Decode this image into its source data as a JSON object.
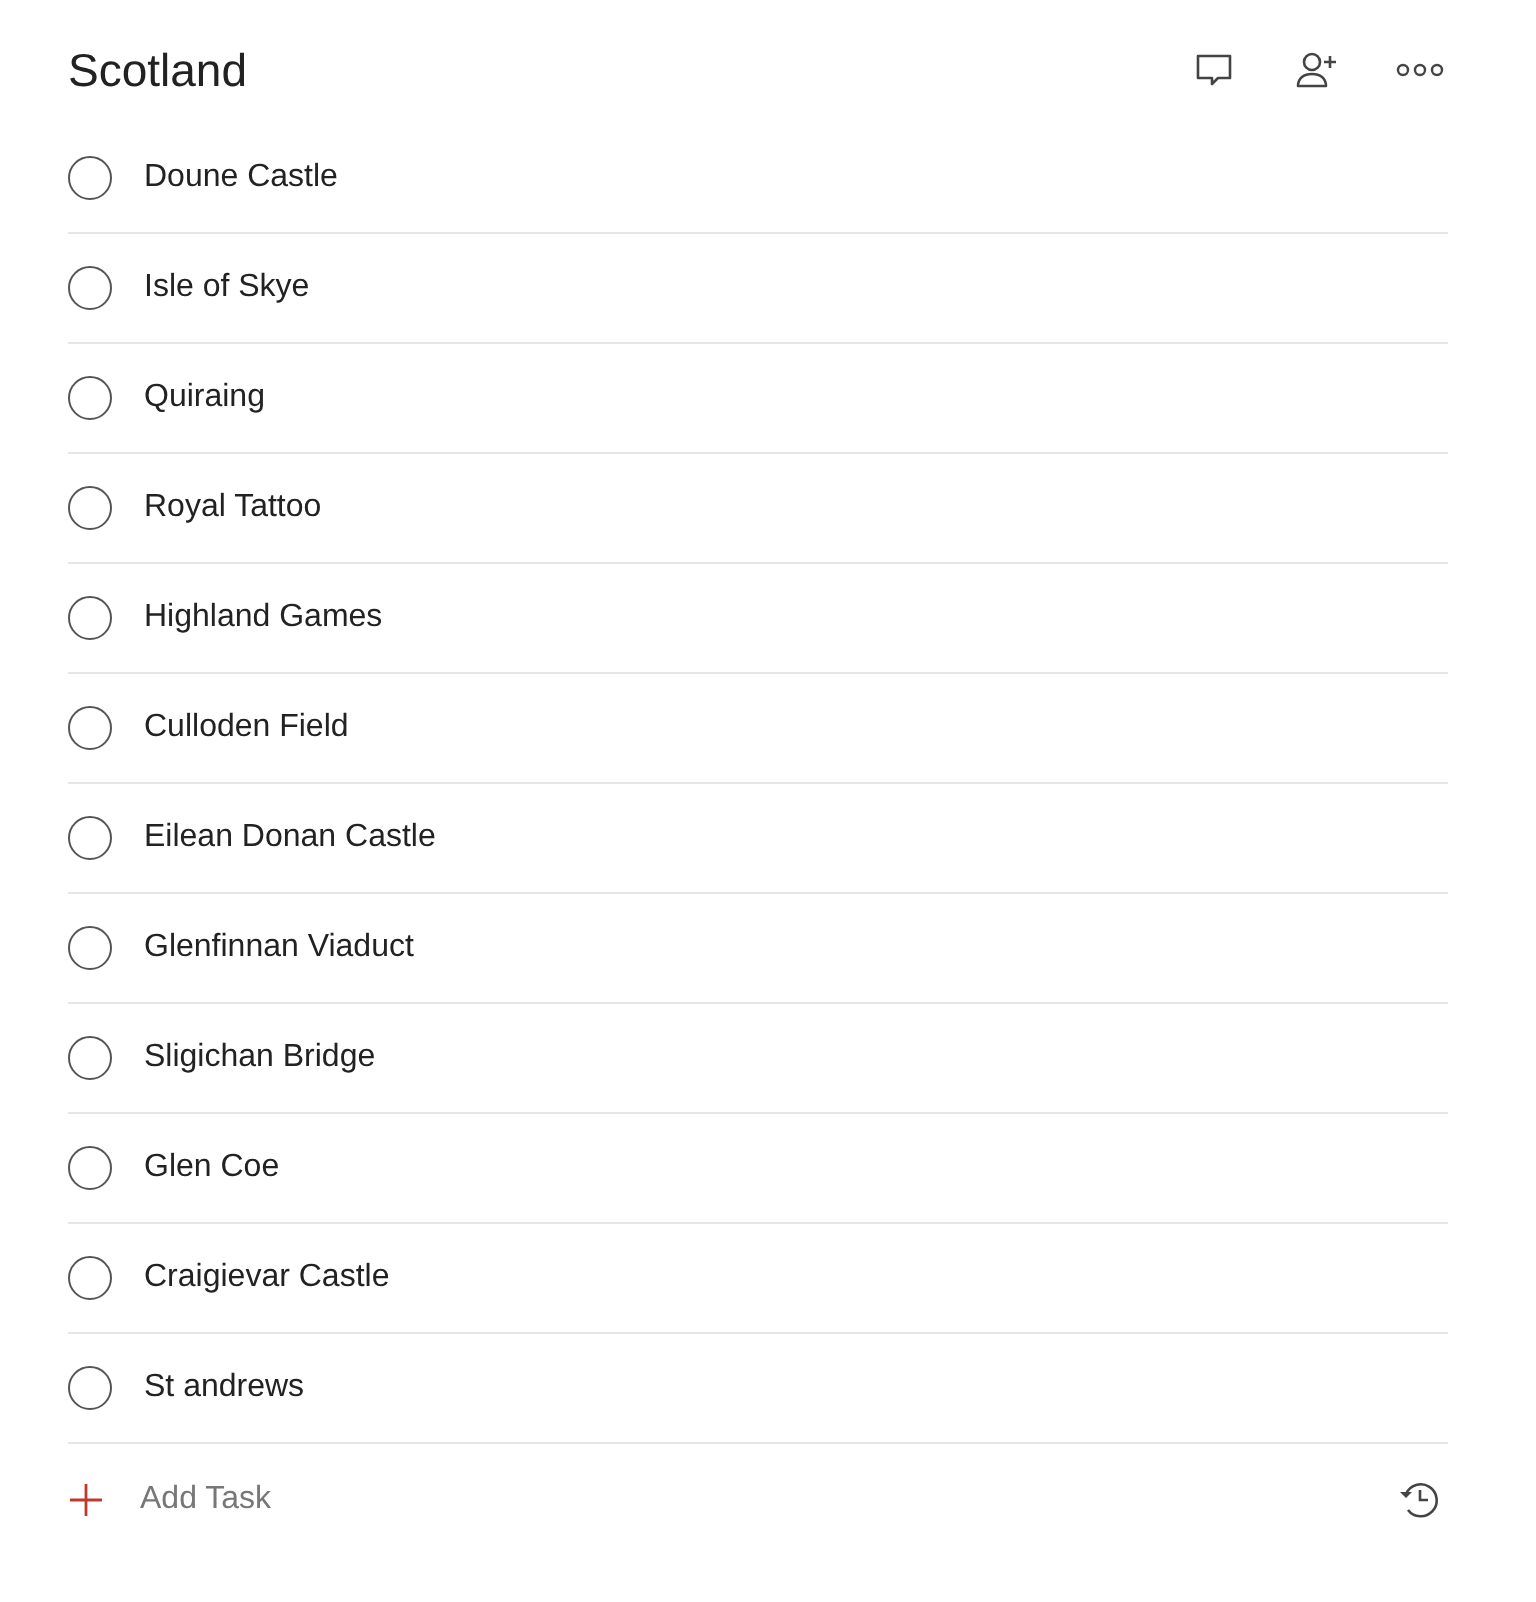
{
  "title": "Scotland",
  "tasks": [
    {
      "label": "Doune Castle",
      "checked": false
    },
    {
      "label": "Isle of Skye",
      "checked": false
    },
    {
      "label": "Quiraing",
      "checked": false
    },
    {
      "label": "Royal Tattoo",
      "checked": false
    },
    {
      "label": "Highland Games",
      "checked": false
    },
    {
      "label": "Culloden Field",
      "checked": false
    },
    {
      "label": "Eilean Donan Castle",
      "checked": false
    },
    {
      "label": "Glenfinnan Viaduct",
      "checked": false
    },
    {
      "label": "Sligichan Bridge",
      "checked": false
    },
    {
      "label": "Glen Coe",
      "checked": false
    },
    {
      "label": "Craigievar Castle",
      "checked": false
    },
    {
      "label": "St andrews",
      "checked": false
    }
  ],
  "add_task": {
    "placeholder": "Add Task"
  }
}
